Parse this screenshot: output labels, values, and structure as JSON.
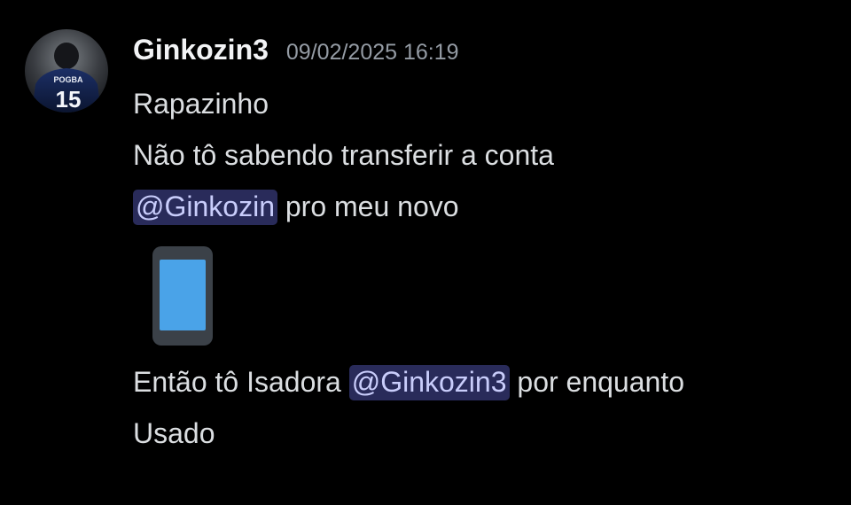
{
  "message": {
    "author": {
      "username": "Ginkozin3",
      "avatar_jersey_name": "POGBA",
      "avatar_jersey_number": "15"
    },
    "timestamp": "09/02/2025 16:19",
    "lines": {
      "l1": "Rapazinho",
      "l2": "Não tô sabendo transferir a conta",
      "l3_mention": "@Ginkozin",
      "l3_text": " pro meu novo",
      "l4_emoji": "mobile-phone-emoji",
      "l5_text_a": "Então tô Isadora ",
      "l5_mention": "@Ginkozin3",
      "l5_text_b": " por enquanto",
      "l6": "Usado"
    }
  },
  "colors": {
    "background": "#000000",
    "username": "#f2f3f5",
    "timestamp": "#949ba4",
    "text": "#dbdee1",
    "mention_bg": "#292b5a",
    "mention_text": "#c9cdfb"
  }
}
